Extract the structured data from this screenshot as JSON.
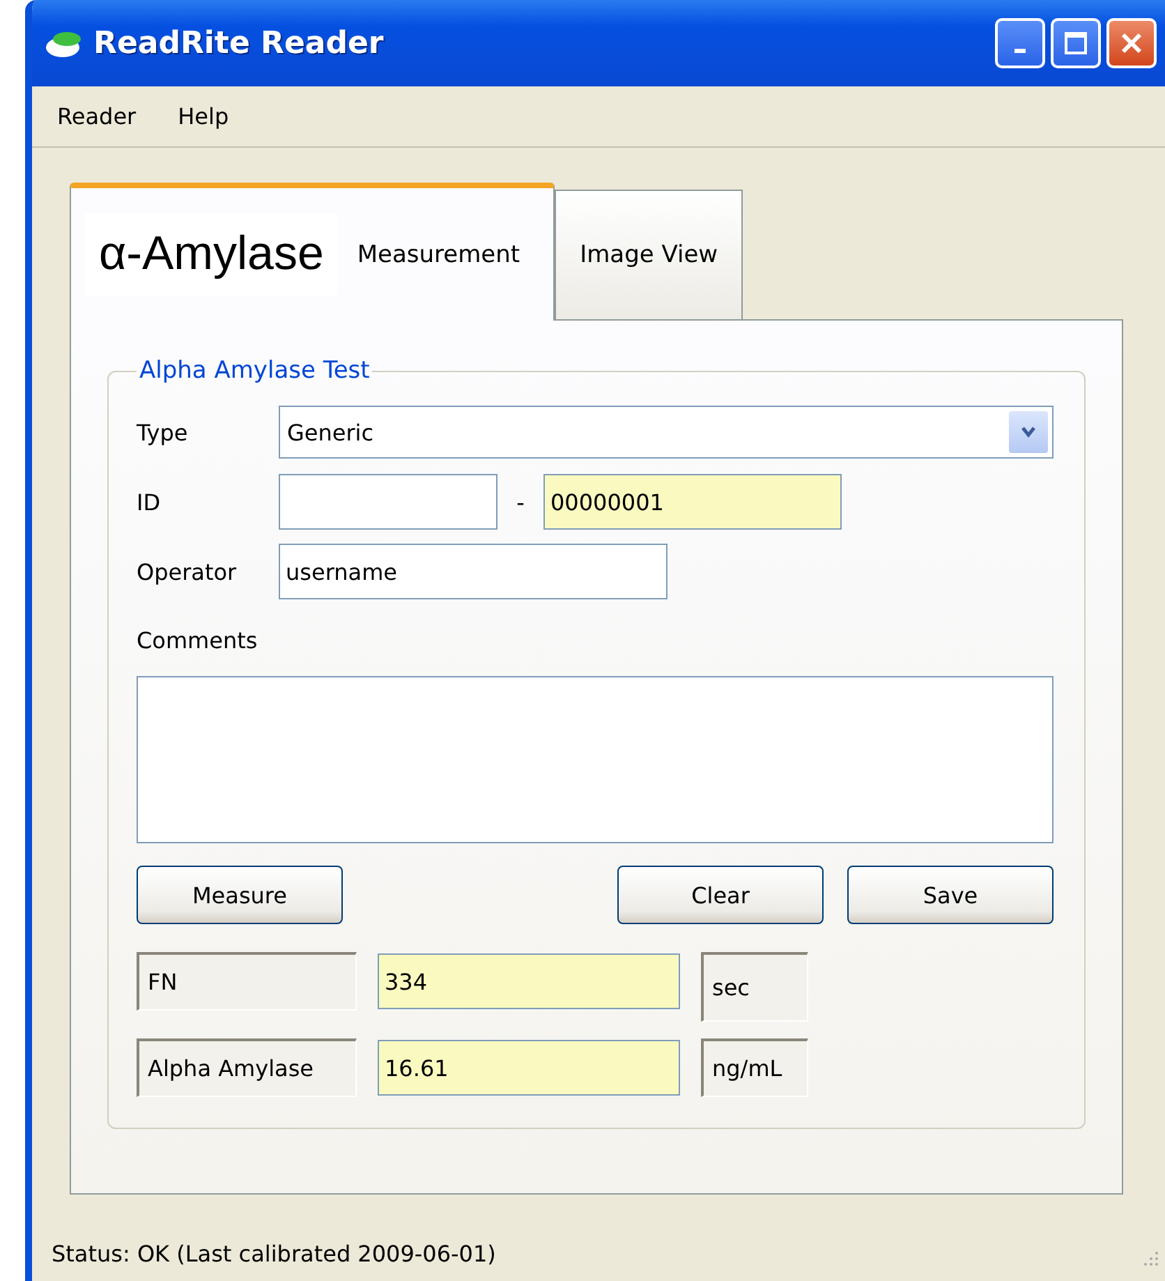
{
  "window": {
    "title": "ReadRite Reader"
  },
  "menu": [
    "Reader",
    "Help"
  ],
  "tabs": [
    {
      "logo": "α-Amylase",
      "label": "Measurement",
      "selected": true
    },
    {
      "label": "Image View",
      "selected": false
    }
  ],
  "group": {
    "title": "Alpha Amylase Test",
    "type": {
      "label": "Type",
      "value": "Generic"
    },
    "id": {
      "label": "ID",
      "separator": "-",
      "number": "00000001"
    },
    "operator": {
      "label": "Operator",
      "value": "username"
    },
    "comments": {
      "label": "Comments"
    },
    "buttons": {
      "left": [
        "Measure"
      ],
      "right": [
        "Clear",
        "Save"
      ]
    },
    "results": [
      {
        "name": "FN",
        "value": "334",
        "unit": "sec"
      },
      {
        "name": "Alpha Amylase",
        "value": "16.61",
        "unit": "ng/mL"
      }
    ]
  },
  "status_bar": "Status: OK (Last calibrated 2009-06-01)"
}
